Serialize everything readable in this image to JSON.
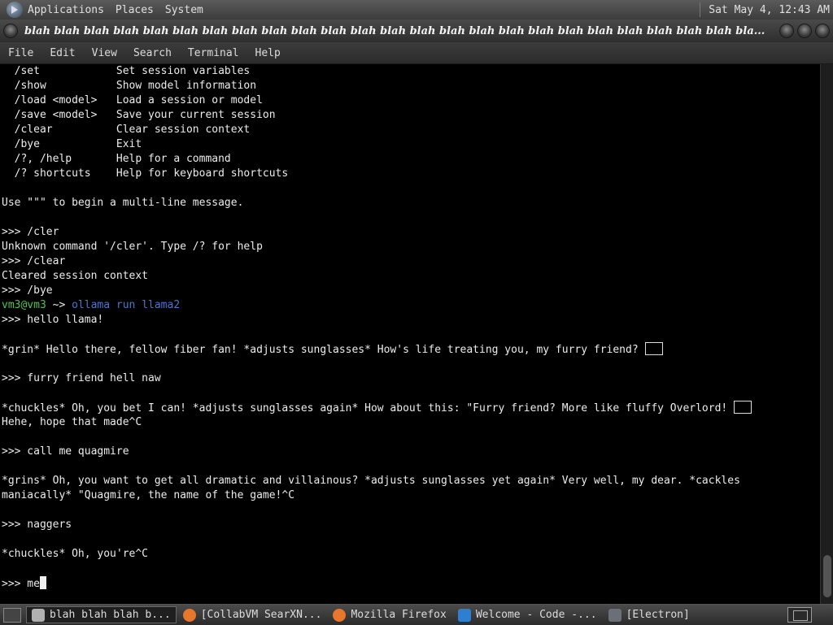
{
  "top_panel": {
    "menus": [
      "Applications",
      "Places",
      "System"
    ],
    "clock": "Sat May  4, 12:43 AM"
  },
  "window": {
    "title": "blah blah blah blah blah blah blah blah blah blah blah blah blah blah blah blah blah blah blah blah blah blah blah blah bla..."
  },
  "menubar": {
    "items": [
      "File",
      "Edit",
      "View",
      "Search",
      "Terminal",
      "Help"
    ]
  },
  "terminal": {
    "lines": [
      {
        "text": "  /set            Set session variables"
      },
      {
        "text": "  /show           Show model information"
      },
      {
        "text": "  /load <model>   Load a session or model"
      },
      {
        "text": "  /save <model>   Save your current session"
      },
      {
        "text": "  /clear          Clear session context"
      },
      {
        "text": "  /bye            Exit"
      },
      {
        "text": "  /?, /help       Help for a command"
      },
      {
        "text": "  /? shortcuts    Help for keyboard shortcuts"
      },
      {
        "text": ""
      },
      {
        "text": "Use \"\"\" to begin a multi-line message."
      },
      {
        "text": ""
      },
      {
        "text": ">>> /cler"
      },
      {
        "text": "Unknown command '/cler'. Type /? for help"
      },
      {
        "text": ">>> /clear"
      },
      {
        "text": "Cleared session context"
      },
      {
        "text": ">>> /bye"
      },
      {
        "kind": "prompt",
        "user": "vm3@vm3",
        "arrow": " ~> ",
        "cmd": "ollama run llama2"
      },
      {
        "text": ">>> hello llama!"
      },
      {
        "text": ""
      },
      {
        "text": "*grin* Hello there, fellow fiber fan! *adjusts sunglasses* How's life treating you, my furry friend? ",
        "emoji": true
      },
      {
        "text": ""
      },
      {
        "text": ">>> furry friend hell naw"
      },
      {
        "text": ""
      },
      {
        "text": "*chuckles* Oh, you bet I can! *adjusts sunglasses again* How about this: \"Furry friend? More like fluffy Overlord! ",
        "emoji": true
      },
      {
        "text": "Hehe, hope that made^C"
      },
      {
        "text": ""
      },
      {
        "text": ">>> call me quagmire"
      },
      {
        "text": ""
      },
      {
        "text": "*grins* Oh, you want to get all dramatic and villainous? *adjusts sunglasses yet again* Very well, my dear. *cackles"
      },
      {
        "text": "maniacally* \"Quagmire, the name of the game!^C"
      },
      {
        "text": ""
      },
      {
        "text": ">>> naggers"
      },
      {
        "text": ""
      },
      {
        "text": "*chuckles* Oh, you're^C"
      },
      {
        "text": ""
      },
      {
        "text": ">>> me",
        "cursor": true
      }
    ]
  },
  "taskbar": {
    "tasks": [
      {
        "label": "blah blah blah b...",
        "icon": "terminal-icon",
        "color": "#b0b0b0",
        "active": true
      },
      {
        "label": "[CollabVM SearXN...",
        "icon": "firefox-icon",
        "color": "#e8762b",
        "active": false
      },
      {
        "label": "Mozilla Firefox",
        "icon": "firefox-icon",
        "color": "#e8762b",
        "active": false
      },
      {
        "label": "Welcome - Code -...",
        "icon": "vscode-icon",
        "color": "#2f7fd1",
        "active": false
      },
      {
        "label": "[Electron]",
        "icon": "electron-icon",
        "color": "#6a6f78",
        "active": false
      }
    ]
  }
}
